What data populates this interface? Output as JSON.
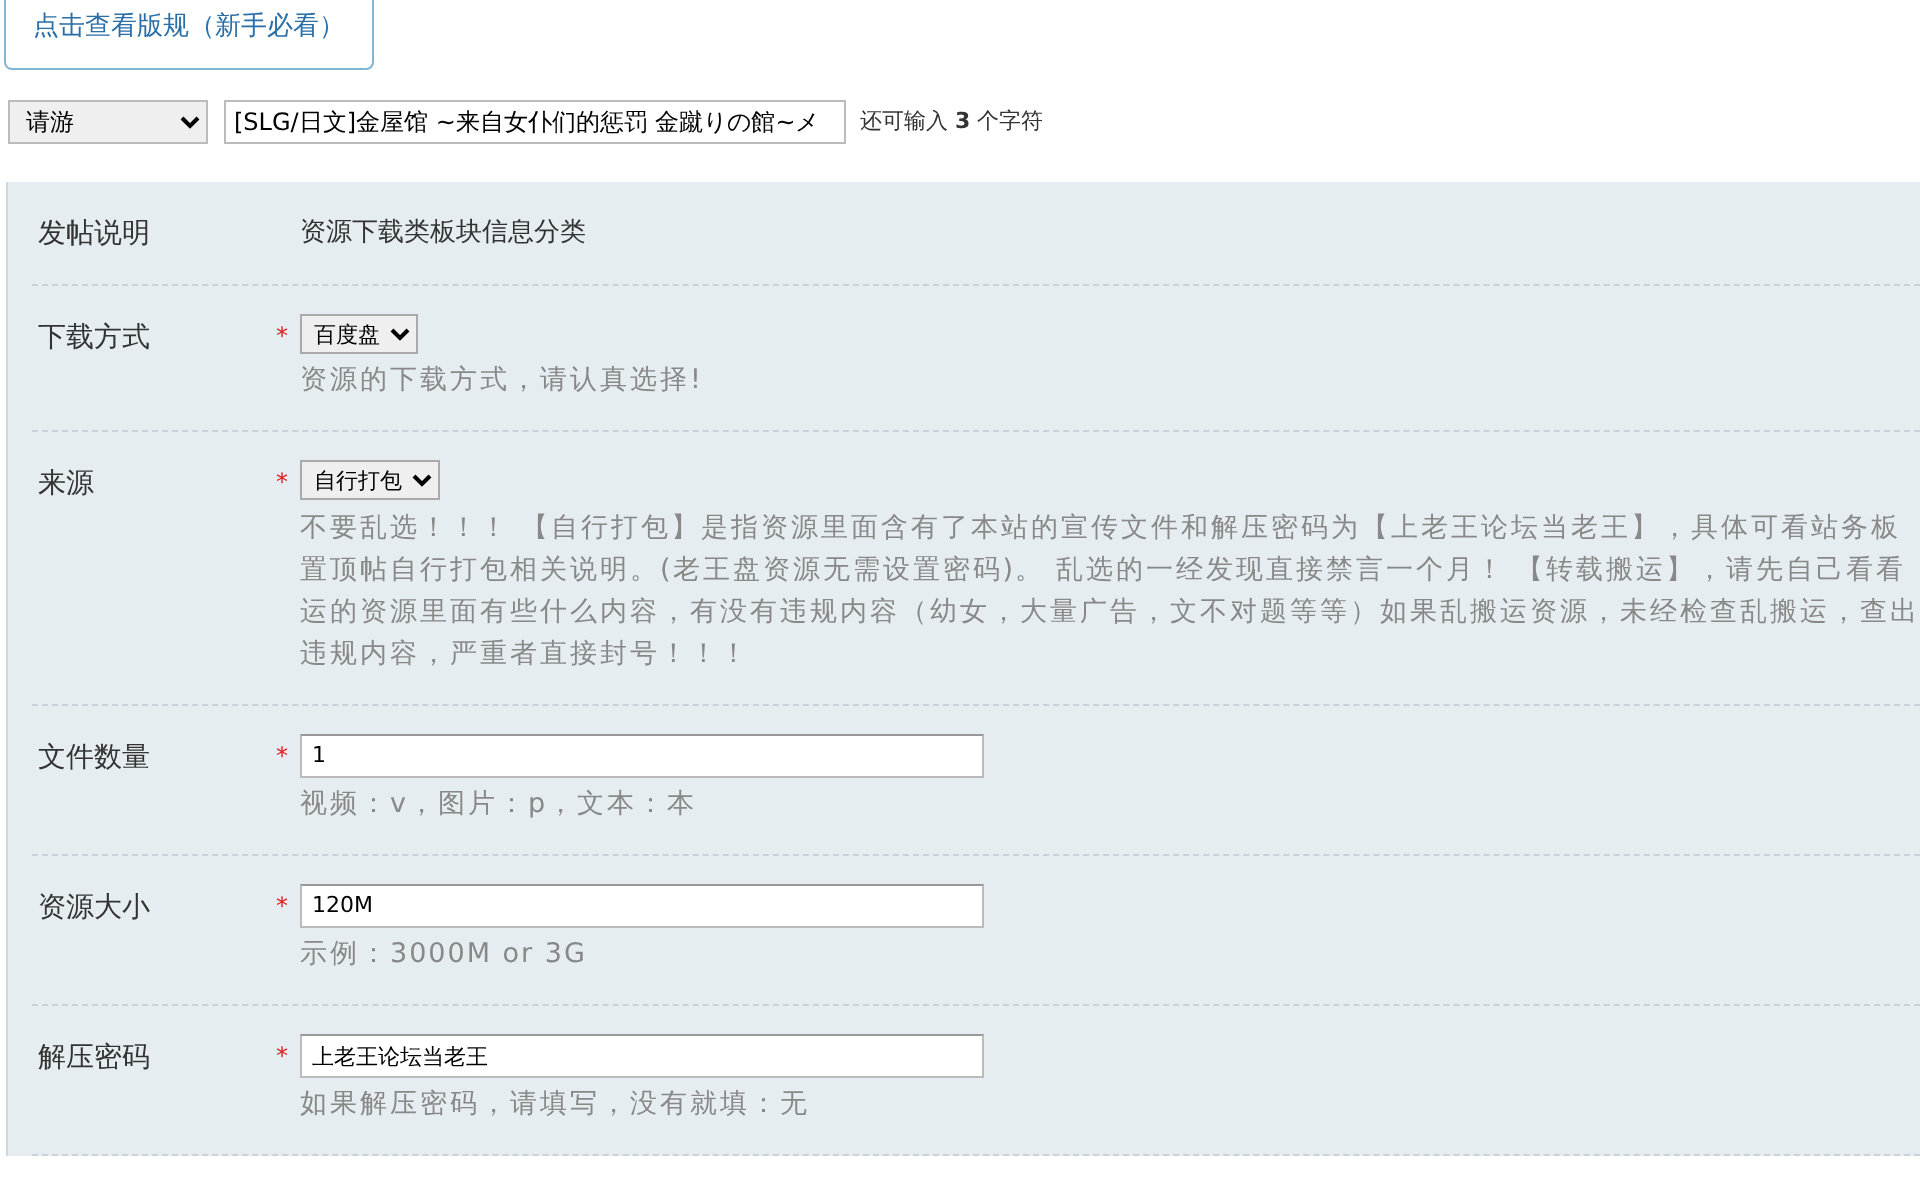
{
  "rules_button": "点击查看版规（新手必看）",
  "title_row": {
    "category": "请游",
    "title": "[SLG/日文]金屋馆 ~来自女仆们的惩罚 金蹴りの館~メ",
    "counter_before": "还可输入",
    "counter_number": "3",
    "counter_after": "个字符"
  },
  "form": [
    {
      "kind": "text",
      "label": "发帖说明",
      "value": "资源下载类板块信息分类"
    },
    {
      "kind": "select",
      "label": "下载方式",
      "required": "*",
      "value": "百度盘",
      "hint_lines": [
        "资源的下载方式，请认真选择!"
      ]
    },
    {
      "kind": "select",
      "label": "来源",
      "required": "*",
      "value": "自行打包",
      "hint_lines": [
        "不要乱选！！！ 【自行打包】是指资源里面含有了本站的宣传文件和解压密码为【上老王论坛当老王】，具体可看站务板",
        "置顶帖自行打包相关说明。(老王盘资源无需设置密码)。 乱选的一经发现直接禁言一个月！ 【转载搬运】，请先自己看看",
        "运的资源里面有些什么内容，有没有违规内容（幼女，大量广告，文不对题等等）如果乱搬运资源，未经检查乱搬运，查出",
        "违规内容，严重者直接封号！！！"
      ]
    },
    {
      "kind": "input",
      "label": "文件数量",
      "required": "*",
      "value": "1",
      "hint_lines": [
        "视频：v，图片：p，文本：本"
      ]
    },
    {
      "kind": "input",
      "label": "资源大小",
      "required": "*",
      "value": "120M",
      "hint_lines": [
        "示例：3000M or 3G"
      ]
    },
    {
      "kind": "input",
      "label": "解压密码",
      "required": "*",
      "value": "上老王论坛当老王",
      "hint_lines": [
        "如果解压密码，请填写，没有就填：无"
      ]
    }
  ]
}
